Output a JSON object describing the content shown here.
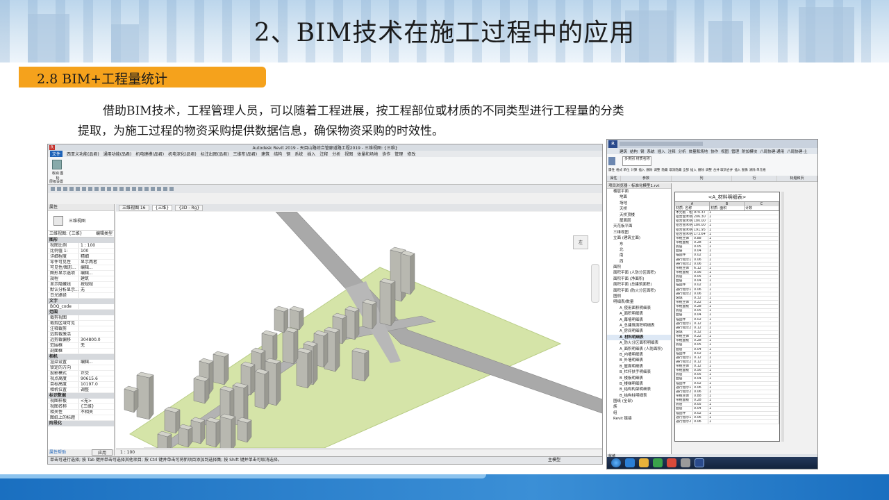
{
  "title": "2、BIM技术在施工过程中的应用",
  "section": "2.8  BIM+工程量统计",
  "paragraph": {
    "line1": "借助BIM技术，工程管理人员，可以随着工程进展，按工程部位或材质的不同类型进行工程量的分类",
    "line2": "提取，为施工过程的物资采购提供数据信息，确保物资采购的时效性。"
  },
  "revit": {
    "window_title": "Autodesk Revit 2019 - 天目山路综合管廊道路工程2019 - 三维视图: {三维}",
    "tabs": [
      "文件",
      "西亚义功能(品君)",
      "通用功能(品君)",
      "机电建模(品君)",
      "机电深化(品君)",
      "标注出图(品君)",
      "三维布(品君)",
      "建筑",
      "结构",
      "钢",
      "系统",
      "插入",
      "注释",
      "分析",
      "视图",
      "体量和场地",
      "协作",
      "管理",
      "修改"
    ],
    "ribbon_label": "收纳 图标",
    "panel_label": "层级设置",
    "properties_header": "属性",
    "type_name": "三维视图",
    "view_selector": "三维视图: {三维}",
    "edit_type": "编辑类型",
    "groups": [
      {
        "name": "图形",
        "rows": [
          [
            "视图比例",
            "1 : 100"
          ],
          [
            "比例值 1:",
            "100"
          ],
          [
            "详细程度",
            "精细"
          ],
          [
            "零件可见性",
            "显示两者"
          ],
          [
            "可见性/图形...",
            "编辑..."
          ],
          [
            "图形显示选项",
            "编辑..."
          ],
          [
            "规程",
            "建筑"
          ],
          [
            "显示隐藏线",
            "按规程"
          ],
          [
            "默认分析显示...",
            "无"
          ],
          [
            "日光路径",
            ""
          ]
        ]
      },
      {
        "name": "文字",
        "rows": [
          [
            "BOQ_code",
            ""
          ]
        ]
      },
      {
        "name": "范围",
        "rows": [
          [
            "裁剪视图",
            ""
          ],
          [
            "裁剪区域可见",
            ""
          ],
          [
            "注释裁剪",
            ""
          ],
          [
            "远剪裁激活",
            ""
          ],
          [
            "远剪裁偏移",
            "304800.0"
          ],
          [
            "范围框",
            "无"
          ],
          [
            "剖面框",
            ""
          ]
        ]
      },
      {
        "name": "相机",
        "rows": [
          [
            "渲染设置",
            "编辑..."
          ],
          [
            "锁定的方向",
            ""
          ],
          [
            "投影模式",
            "正交"
          ],
          [
            "视点高度",
            "90615.6"
          ],
          [
            "目标高度",
            "10197.0"
          ],
          [
            "相机位置",
            "调整"
          ]
        ]
      },
      {
        "name": "标识数据",
        "rows": [
          [
            "视图样板",
            "<无>"
          ],
          [
            "视图名称",
            "{三维}"
          ],
          [
            "相关性",
            "不相关"
          ],
          [
            "图纸上的标题",
            ""
          ]
        ]
      },
      {
        "name": "阶段化",
        "rows": []
      }
    ],
    "help_link": "属性帮助",
    "apply_button": "应用",
    "view_tabs": [
      "三维视图 16",
      "{三维}",
      "{3D - Rg}"
    ],
    "scale_bar": "1 : 100",
    "status_text": "单击可进行选择; 按 Tab 键并单击可选择其他项目; 按 Ctrl 键并单击可将新项目添加到选择集; 按 Shift 键并单击可取消选择。",
    "status_model": "主模型",
    "viewcube_face": "左"
  },
  "schedule": {
    "tabs": [
      "建筑",
      "结构",
      "钢",
      "系统",
      "插入",
      "注释",
      "分析",
      "体量和场地",
      "协作",
      "视图",
      "管理",
      "附加模块",
      "八局协建-通用",
      "八局协建-土"
    ],
    "ribbon_groups": [
      "属性",
      "参数",
      "列",
      "行",
      "标题和页"
    ],
    "type_selector": "多类别 材质名称",
    "ribbon_labels": [
      "属性",
      "格式 单位",
      "计算",
      "插入",
      "删除",
      "调整",
      "隐藏",
      "取消隐藏 全部",
      "插入",
      "删除",
      "调整",
      "合并 取消合并",
      "插入 图像",
      "清除 单元格"
    ],
    "browser_header": "项目浏览器 - 标准化模型1.rvt",
    "browser_items": [
      "楼层平面",
      "地面",
      "场地",
      "天桥",
      "天桥顶楼",
      "屋面层",
      "天花板平面",
      "三维视图",
      "立面 (建筑立面)",
      "东",
      "北",
      "南",
      "西",
      "面积",
      "面积平面 (人防分区面积)",
      "面积平面 (净面积)",
      "面积平面 (总建筑面积)",
      "面积平面 (防火分区面积)",
      "图例",
      "明细表/数量",
      "A_使用面积明细表",
      "A_面积明细表",
      "A_幕墙明细表",
      "A_总建筑面积明细表",
      "A_房间明细表",
      "A_材料明细表",
      "A_防火分区面积明细表",
      "A_面积明细表 (人防面积)",
      "B_内墙明细表",
      "B_外墙明细表",
      "B_屋面明细表",
      "B_栏杆扶手明细表",
      "B_楼板明细表",
      "B_楼梯明细表",
      "B_结构构架明细表",
      "B_结构柱明细表",
      "图纸 (全部)",
      "族",
      "组",
      "Revit 链接"
    ],
    "table_title": "<A_材料明细表>",
    "col_letters": [
      "A",
      "B",
      "C"
    ],
    "col_headers": [
      "材质: 名称",
      "材质: 面积",
      "计数"
    ],
    "rows": [
      [
        "木元板 - 松木 600 x 1",
        "970.37",
        "1"
      ],
      [
        "铝合金木枋",
        "206.30",
        "1"
      ],
      [
        "铝合金木枋",
        "180.00",
        "1"
      ],
      [
        "铝合金木枋",
        "180.00",
        "1"
      ],
      [
        "铝合金木枋",
        "191.95",
        "1"
      ],
      [
        "铝合金木枋",
        "173.64",
        "1"
      ],
      [
        "带框主体",
        "0.88",
        "1"
      ],
      [
        "带框面板",
        "0.28",
        "1"
      ],
      [
        "底层",
        "0.05",
        "1"
      ],
      [
        "面层",
        "0.04",
        "1"
      ],
      [
        "锚固件",
        "0.02",
        "1"
      ],
      [
        "通行指示1",
        "0.06",
        "1"
      ],
      [
        "通行指示2",
        "0.06",
        "1"
      ],
      [
        "带框主体",
        "6.12",
        "1"
      ],
      [
        "带框面板",
        "0.56",
        "1"
      ],
      [
        "底层",
        "0.05",
        "1"
      ],
      [
        "面层",
        "0.04",
        "1"
      ],
      [
        "锚固件",
        "0.02",
        "1"
      ],
      [
        "通行指示1",
        "0.06",
        "1"
      ],
      [
        "通行指示2",
        "0.06",
        "1"
      ],
      [
        "玻璃",
        "0.32",
        "1"
      ],
      [
        "带框主体",
        "0.22",
        "1"
      ],
      [
        "带框面板",
        "0.28",
        "1"
      ],
      [
        "底层",
        "0.05",
        "1"
      ],
      [
        "面层",
        "0.04",
        "1"
      ],
      [
        "锚固件",
        "0.02",
        "1"
      ],
      [
        "通行指示1",
        "0.12",
        "1"
      ],
      [
        "通行指示2",
        "0.12",
        "1"
      ],
      [
        "玻璃",
        "0.32",
        "1"
      ],
      [
        "带框主体",
        "0.22",
        "1"
      ],
      [
        "带框面板",
        "0.28",
        "1"
      ],
      [
        "底层",
        "0.05",
        "1"
      ],
      [
        "面层",
        "0.04",
        "1"
      ],
      [
        "锚固件",
        "0.02",
        "1"
      ],
      [
        "通行指示1",
        "0.12",
        "1"
      ],
      [
        "通行指示2",
        "0.12",
        "1"
      ],
      [
        "带框主体",
        "0.12",
        "1"
      ],
      [
        "带框面板",
        "0.56",
        "1"
      ],
      [
        "底层",
        "0.05",
        "1"
      ],
      [
        "面层",
        "0.04",
        "1"
      ],
      [
        "锚固件",
        "0.02",
        "1"
      ],
      [
        "通行指示1",
        "0.06",
        "1"
      ],
      [
        "通行指示2",
        "0.06",
        "1"
      ],
      [
        "带框主体",
        "0.88",
        "1"
      ],
      [
        "带框面板",
        "0.28",
        "1"
      ],
      [
        "底层",
        "0.05",
        "1"
      ],
      [
        "面层",
        "0.04",
        "1"
      ],
      [
        "锚固件",
        "0.02",
        "1"
      ],
      [
        "通行指示1",
        "0.06",
        "1"
      ],
      [
        "通行指示2",
        "0.06",
        "1"
      ]
    ],
    "status_text": "就绪"
  }
}
